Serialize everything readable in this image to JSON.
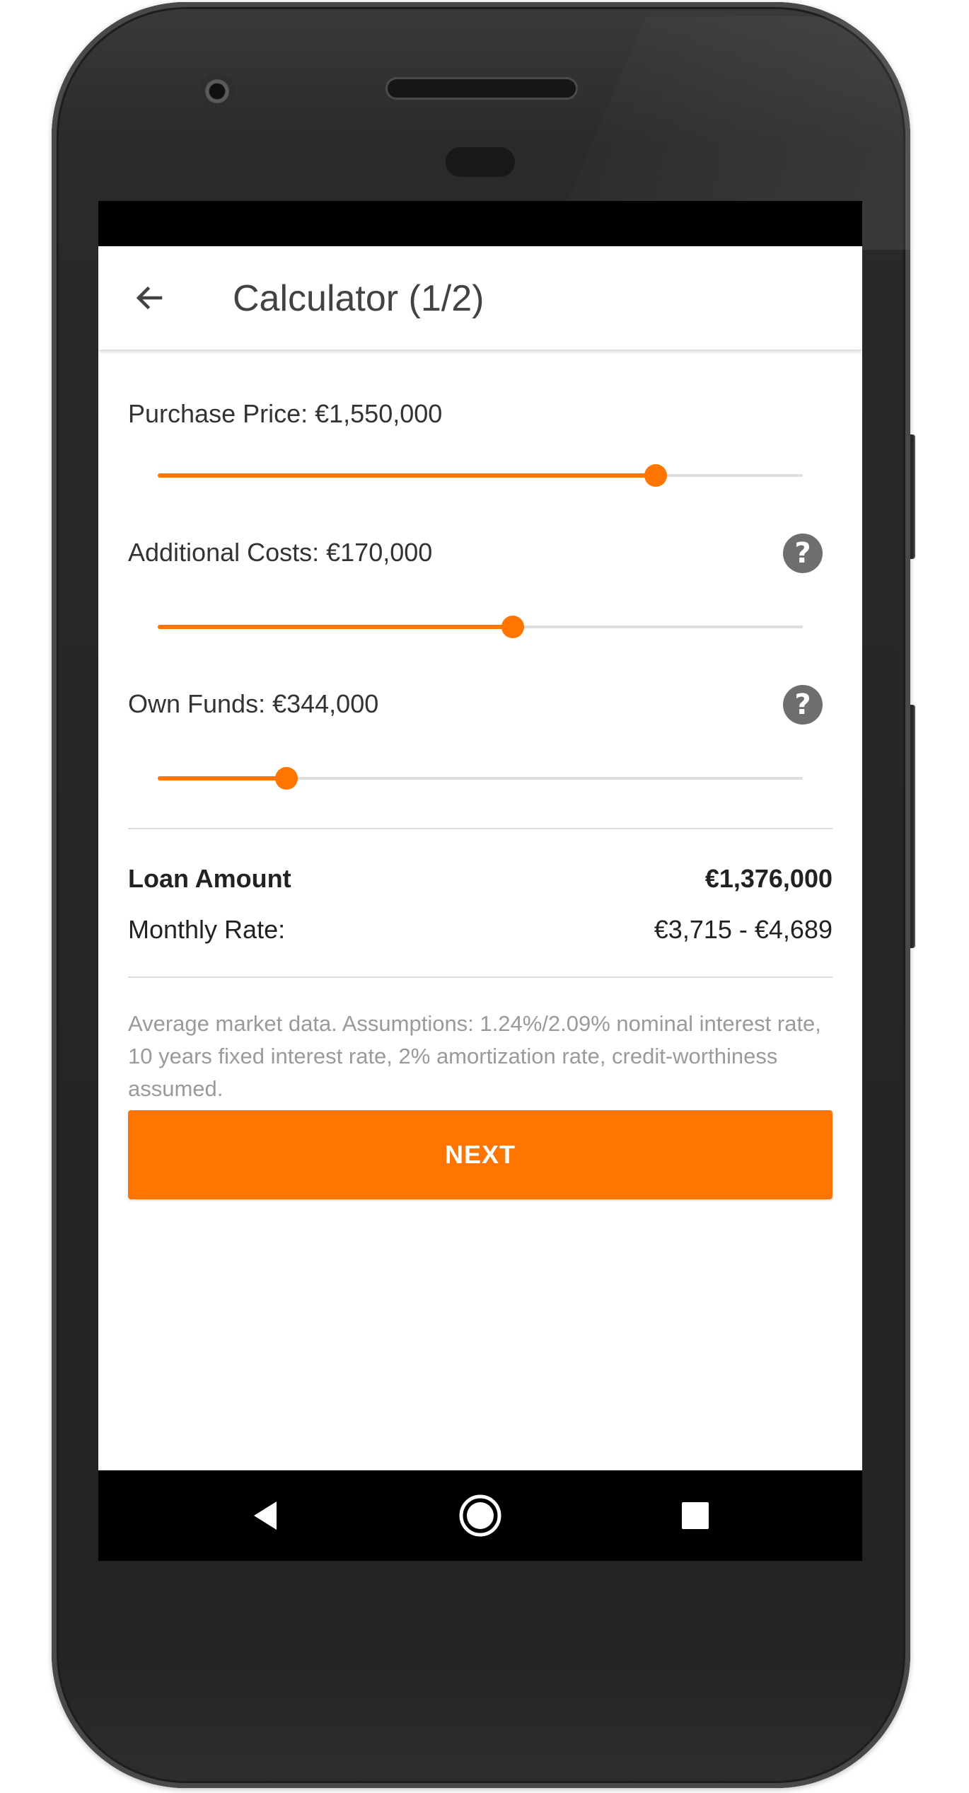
{
  "app_bar": {
    "title": "Calculator (1/2)",
    "back_icon": "arrow-left-icon"
  },
  "fields": {
    "purchase_price": {
      "label": "Purchase Price: €1,550,000",
      "slider_fraction": 0.772
    },
    "additional_costs": {
      "label": "Additional Costs: €170,000",
      "slider_fraction": 0.55,
      "help_icon": "question-mark-circle-icon",
      "help_glyph": "?"
    },
    "own_funds": {
      "label": "Own Funds: €344,000",
      "slider_fraction": 0.2,
      "help_icon": "question-mark-circle-icon",
      "help_glyph": "?"
    }
  },
  "summary": {
    "loan_amount_label": "Loan Amount",
    "loan_amount_value": "€1,376,000",
    "monthly_rate_label": "Monthly Rate:",
    "monthly_rate_value": "€3,715 - €4,689"
  },
  "disclaimer": "Average market data. Assumptions: 1.24%/2.09% nominal interest rate, 10 years fixed interest rate, 2% amortization rate, credit-worthiness assumed.",
  "next_button_label": "NEXT",
  "nav_bar": {
    "back_icon": "triangle-back-icon",
    "home_icon": "circle-home-icon",
    "recents_icon": "square-recents-icon"
  },
  "colors": {
    "accent": "#ff7500",
    "help_icon": "#6e6e6e",
    "text_primary": "#222222",
    "text_secondary": "#9a9a9a",
    "track": "#dedede"
  }
}
